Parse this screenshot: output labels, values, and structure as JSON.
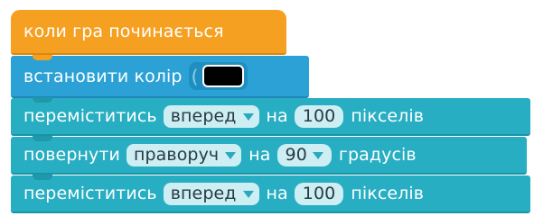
{
  "blocks": {
    "hat": {
      "label": "коли гра починається",
      "color": "#f5a021"
    },
    "set_color": {
      "label": "встановити колір",
      "bracket": "(",
      "swatch_color": "#000000",
      "color": "#2ba1d6"
    },
    "move1": {
      "label": "переміститись",
      "direction": "вперед",
      "on": "на",
      "value": "100",
      "unit": "пікселів",
      "color": "#27aec2"
    },
    "turn": {
      "label": "повернути",
      "direction": "праворуч",
      "on": "на",
      "value": "90",
      "unit": "градусів",
      "color": "#27aec2"
    },
    "move2": {
      "label": "переміститись",
      "direction": "вперед",
      "on": "на",
      "value": "100",
      "unit": "пікселів",
      "color": "#27aec2"
    }
  },
  "icons": {
    "dropdown": "triangle-down-icon",
    "swatch": "color-swatch"
  }
}
